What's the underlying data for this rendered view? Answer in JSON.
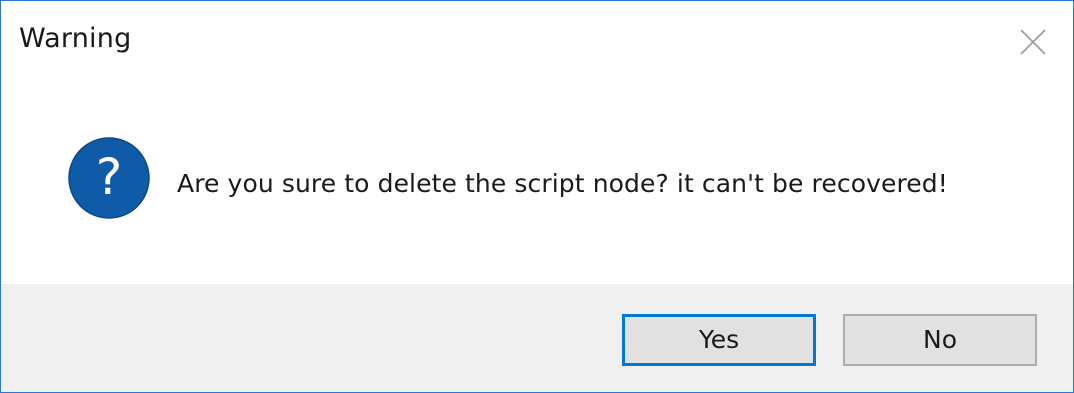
{
  "dialog": {
    "title": "Warning",
    "message": "Are you sure to delete the script node? it can't be recovered!",
    "icon": "question-icon",
    "close_icon": "close-icon",
    "buttons": {
      "yes_label": "Yes",
      "no_label": "No"
    }
  },
  "colors": {
    "accent": "#0078d7",
    "window_border": "#2b79d6",
    "icon_fill": "#0f5ba7",
    "footer_bg": "#f0f0f0",
    "button_bg": "#e1e1e1"
  }
}
